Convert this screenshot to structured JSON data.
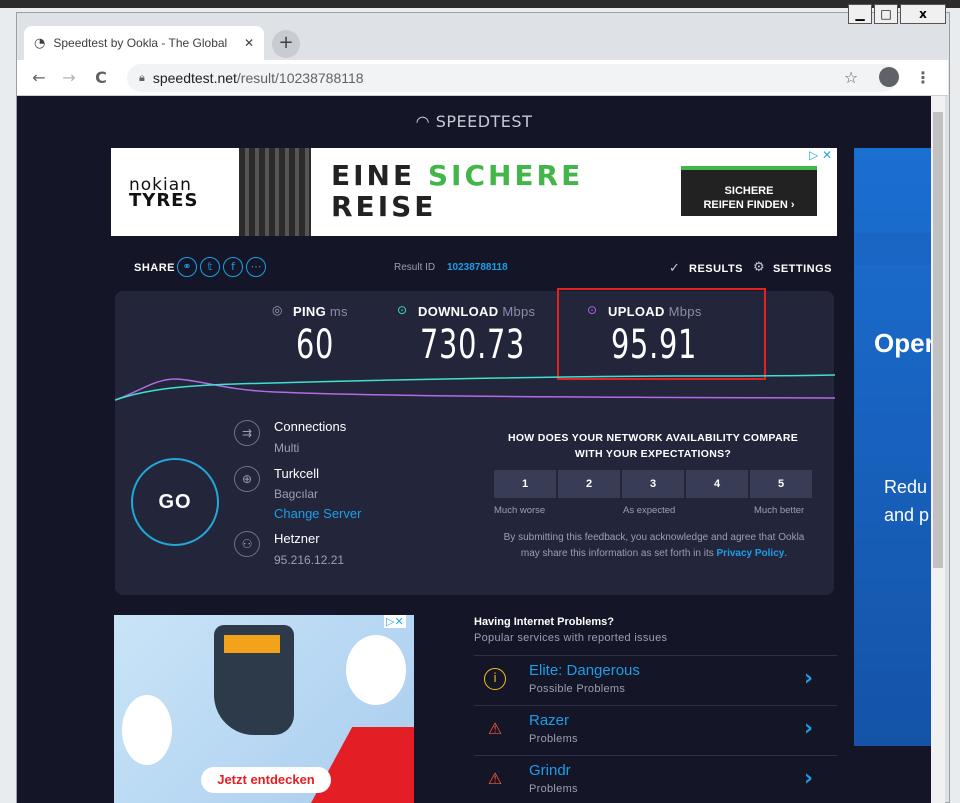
{
  "window": {
    "min_label": "▁",
    "max_label": "□",
    "close_label": "x"
  },
  "tab": {
    "title": "Speedtest by Ookla - The Global",
    "close": "✕",
    "new_tab": "+"
  },
  "toolbar": {
    "back": "←",
    "forward": "→",
    "reload": "C",
    "url_domain": "speedtest.net",
    "url_path": "/result/10238788118",
    "star": "☆",
    "menu": "⋮"
  },
  "brand": "◠ SPEEDTEST",
  "ad_top": {
    "logo_line1": "nokian",
    "logo_line2": "TYRES",
    "headline_a": "EINE ",
    "headline_b": "SICHERE",
    "headline_c": "REISE",
    "cta": "SICHERE\nREIFEN FINDEN ›",
    "adchoice": "▷ ✕"
  },
  "ad_right": {
    "text1": "Oper",
    "text2": "Redu",
    "text3": "and p"
  },
  "share": {
    "label": "SHARE",
    "icons": [
      "link-icon",
      "twitter-icon",
      "facebook-icon",
      "more-icon"
    ]
  },
  "result": {
    "label": "Result ID",
    "id": "10238788118",
    "results": "RESULTS",
    "settings": "SETTINGS"
  },
  "metrics": {
    "ping": {
      "label": "PING",
      "unit": "ms",
      "value": "60"
    },
    "download": {
      "label": "DOWNLOAD",
      "unit": "Mbps",
      "value": "730.73"
    },
    "upload": {
      "label": "UPLOAD",
      "unit": "Mbps",
      "value": "95.91"
    }
  },
  "server": {
    "connections_label": "Connections",
    "connections_value": "Multi",
    "isp": "Turkcell",
    "location": "Bagcılar",
    "change": "Change Server",
    "host": "Hetzner",
    "ip": "95.216.12.21"
  },
  "go": "GO",
  "survey": {
    "question": "HOW DOES YOUR NETWORK AVAILABILITY COMPARE WITH YOUR EXPECTATIONS?",
    "ratings": [
      "1",
      "2",
      "3",
      "4",
      "5"
    ],
    "low": "Much worse",
    "mid": "As expected",
    "high": "Much better",
    "disclaimer": "By submitting this feedback, you acknowledge and agree that Ookla may share this information as set forth in its",
    "privacy": "Privacy Policy"
  },
  "ad_bottom": {
    "cta": "Jetzt entdecken",
    "adchoice": "▷✕"
  },
  "problems": {
    "title": "Having Internet Problems?",
    "subtitle": "Popular services with reported issues",
    "items": [
      {
        "name": "Elite: Dangerous",
        "status": "Possible Problems",
        "icon": "info-icon"
      },
      {
        "name": "Razer",
        "status": "Problems",
        "icon": "warning-icon"
      },
      {
        "name": "Grindr",
        "status": "Problems",
        "icon": "warning-icon"
      }
    ]
  },
  "colors": {
    "accent": "#1c9ee8",
    "upload": "#b36ae2",
    "download": "#3fe0d0",
    "highlight": "#e32222"
  }
}
